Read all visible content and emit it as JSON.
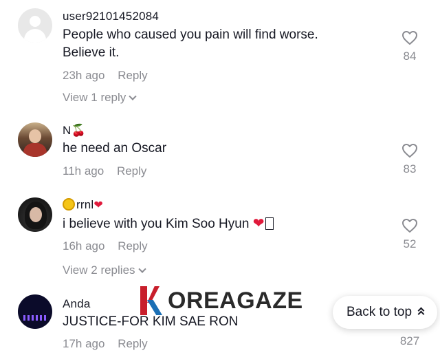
{
  "comments": [
    {
      "username": "user92101452084",
      "text_lines": [
        "People who caused you pain will find worse.",
        "Believe it."
      ],
      "time": "23h ago",
      "reply_label": "Reply",
      "like_count": "84",
      "view_replies": "View 1 reply"
    },
    {
      "username": "N🍒",
      "text_lines": [
        "he need an Oscar"
      ],
      "time": "11h ago",
      "reply_label": "Reply",
      "like_count": "83"
    },
    {
      "username": "rrnl",
      "text_lines": [
        "i believe with you Kim Soo Hyun"
      ],
      "time": "16h ago",
      "reply_label": "Reply",
      "like_count": "52",
      "view_replies": "View 2 replies"
    },
    {
      "username": "Anda",
      "text_lines": [
        "JUSTICE-FOR KIM SAE RON"
      ],
      "time": "17h ago",
      "reply_label": "Reply",
      "like_count": "827"
    }
  ],
  "back_to_top_label": "Back to top",
  "watermark": "OREAGAZE",
  "colors": {
    "text": "#161823",
    "muted": "#8a8b91",
    "heart_red": "#e0193b"
  },
  "icons": {
    "like": "heart-outline-icon",
    "expand": "chevron-down-icon",
    "scroll_top": "double-chevron-up-icon"
  }
}
